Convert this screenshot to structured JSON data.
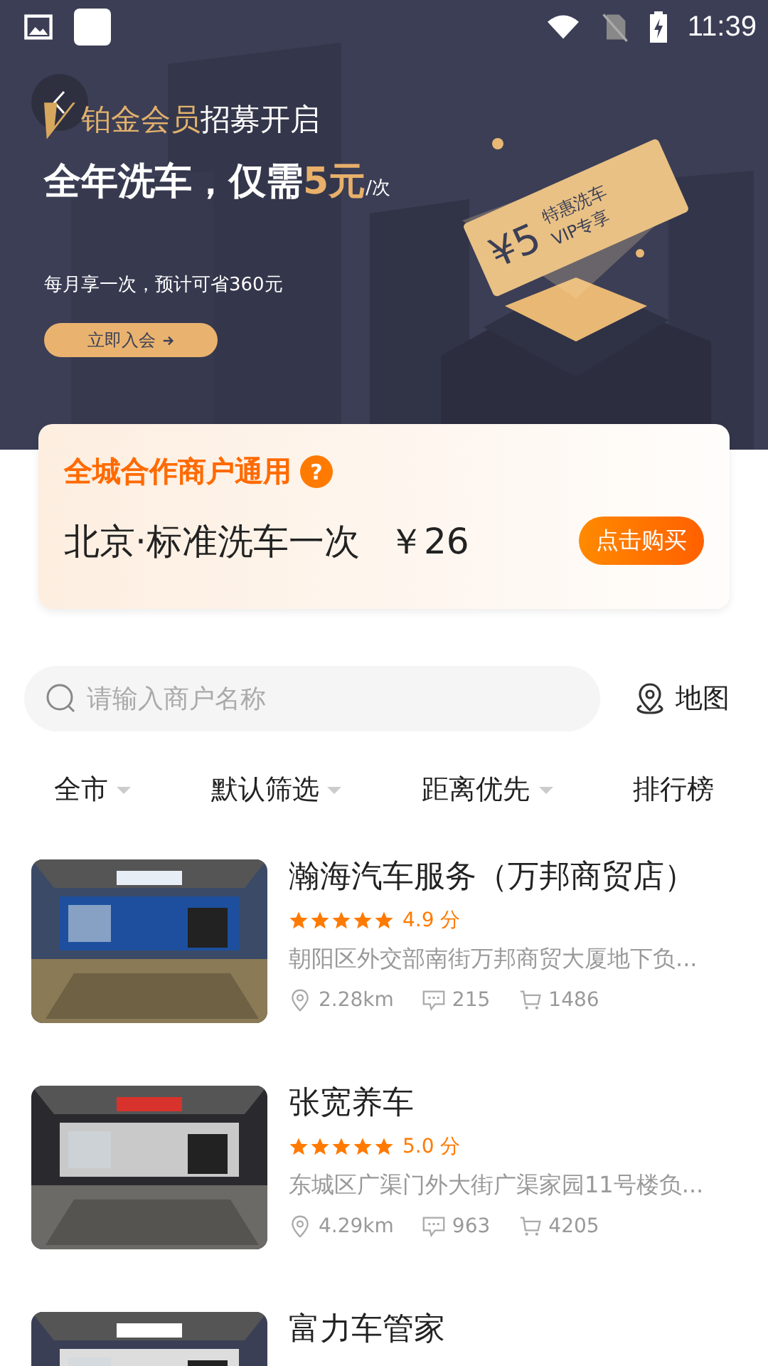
{
  "status_bar": {
    "time": "11:39"
  },
  "banner": {
    "title_gold": "铂金会员",
    "title_white": "招募开启",
    "headline_main": "全年洗车，仅需",
    "headline_price": "5元",
    "headline_unit": "/次",
    "subtitle": "每月享一次，预计可省360元",
    "join_button": "立即入会",
    "ticket_price": "¥5",
    "ticket_line1": "特惠洗车",
    "ticket_line2": "VIP专享"
  },
  "offer_card": {
    "title": "全城合作商户通用",
    "help": "?",
    "product": "北京·标准洗车一次",
    "price": "￥26",
    "buy_button": "点击购买"
  },
  "search": {
    "placeholder": "请输入商户名称",
    "map_button": "地图"
  },
  "filters": [
    {
      "label": "全市",
      "dropdown": true
    },
    {
      "label": "默认筛选",
      "dropdown": true
    },
    {
      "label": "距离优先",
      "dropdown": true
    },
    {
      "label": "排行榜",
      "dropdown": false
    }
  ],
  "shops": [
    {
      "name": "瀚海汽车服务（万邦商贸店）",
      "stars": 5,
      "score": "4.9 分",
      "address": "朝阳区外交部南街万邦商贸大厦地下负...",
      "distance": "2.28km",
      "comments": "215",
      "sales": "1486"
    },
    {
      "name": "张宽养车",
      "stars": 5,
      "score": "5.0 分",
      "address": "东城区广渠门外大街广渠家园11号楼负...",
      "distance": "4.29km",
      "comments": "963",
      "sales": "4205"
    },
    {
      "name": "富力车管家"
    }
  ]
}
